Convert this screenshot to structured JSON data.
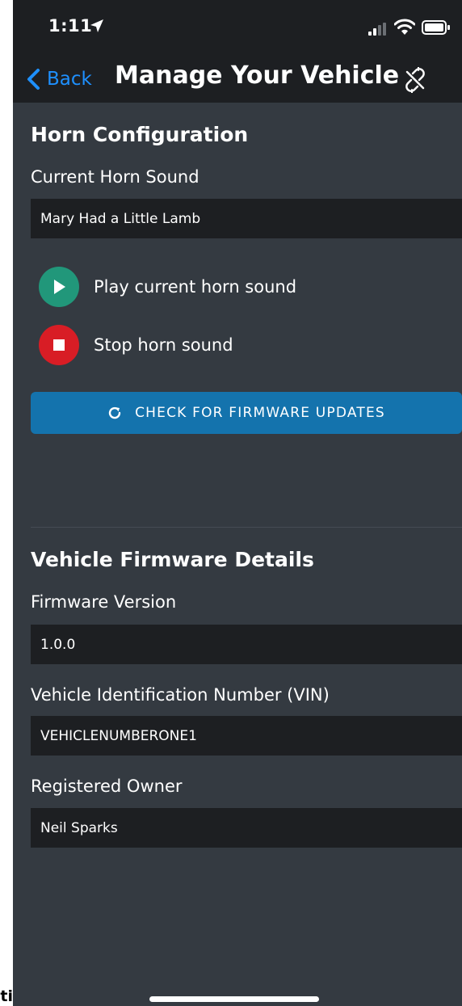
{
  "status_bar": {
    "time": "1:11",
    "icons": [
      "location-arrow-icon",
      "signal-icon",
      "wifi-icon",
      "battery-icon"
    ]
  },
  "nav": {
    "back_label": "Back",
    "title": "Manage Your Vehicle",
    "right_icon": "unlink-icon"
  },
  "horn": {
    "section_title": "Horn Configuration",
    "current_label": "Current Horn Sound",
    "current_value": "Mary Had a Little Lamb",
    "play_label": "Play current horn sound",
    "stop_label": "Stop horn sound",
    "firmware_button_label": "CHECK FOR FIRMWARE UPDATES"
  },
  "firmware": {
    "section_title": "Vehicle Firmware Details",
    "version_label": "Firmware Version",
    "version_value": "1.0.0",
    "vin_label": "Vehicle Identification Number (VIN)",
    "vin_value": "VEHICLENUMBERONE1",
    "owner_label": "Registered Owner",
    "owner_value": "Neil Sparks"
  },
  "edge_text": "ti",
  "colors": {
    "background": "#343a41",
    "bar": "#1d1f22",
    "accent_blue": "#1e90ff",
    "button_blue": "#1473ad",
    "play_green": "#21977a",
    "stop_red": "#d81d25"
  }
}
